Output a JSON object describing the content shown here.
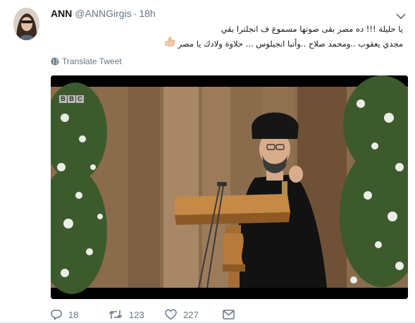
{
  "author": {
    "name": "ANN",
    "handle": "@ANNGirgis",
    "separator": "·",
    "time": "18h"
  },
  "tweet": {
    "line1": "يا حليلة !!! ده مصر بقى صوتها مسموع ف انجلترا بقي",
    "line2": "مجدي يعقوب ..ومحمد صلاح ..وأنبا انجيلوس ... حلاوة ولادك يا مصر",
    "emoji_icon": "thumbs-up-icon"
  },
  "translate_label": "Translate Tweet",
  "media": {
    "watermark": [
      "B",
      "B",
      "C"
    ],
    "description_icon": "video-still"
  },
  "actions": {
    "replies": "18",
    "retweets": "123",
    "likes": "227"
  },
  "colors": {
    "secondary_text": "#657786",
    "primary_text": "#14171a"
  }
}
